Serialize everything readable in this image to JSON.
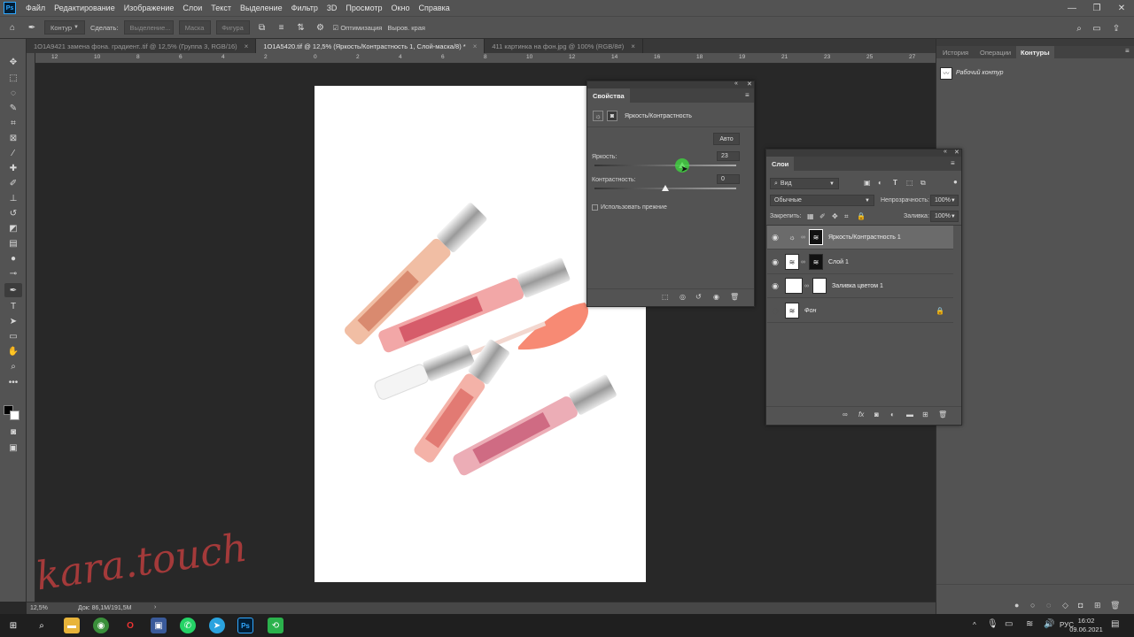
{
  "menubar": {
    "logo": "Ps",
    "items": [
      "Файл",
      "Редактирование",
      "Изображение",
      "Слои",
      "Текст",
      "Выделение",
      "Фильтр",
      "3D",
      "Просмотр",
      "Окно",
      "Справка"
    ]
  },
  "options": {
    "mode": "Контур",
    "make_label": "Сделать:",
    "selection_btn": "Выделение...",
    "mask_btn": "Маска",
    "shape_btn": "Фигура",
    "optimization_label": "Оптимизация",
    "align_edges_label": "Выров. края"
  },
  "doc_tabs": [
    {
      "label": "1O1A9421 замена фона. градиент..tif @ 12,5% (Группа 3, RGB/16)",
      "active": false
    },
    {
      "label": "1O1A5420.tif @ 12,5% (Яркость/Контрастность 1, Слой-маска/8) *",
      "active": true
    },
    {
      "label": "411 картинка на фон.jpg @ 100% (RGB/8#)",
      "active": false
    }
  ],
  "ruler_top": [
    "12",
    "10",
    "8",
    "6",
    "4",
    "2",
    "0",
    "2",
    "4",
    "6",
    "8",
    "10",
    "12",
    "14",
    "16",
    "18",
    "19",
    "21",
    "23",
    "25",
    "27"
  ],
  "status": {
    "zoom": "12,5%",
    "doc_info": "Док: 86,1M/191,5M"
  },
  "right_dock": {
    "tabs": [
      "История",
      "Операции",
      "Контуры"
    ],
    "active_tab": "Контуры",
    "path_item": "Рабочий контур"
  },
  "properties": {
    "tab": "Свойства",
    "adjustment_name": "Яркость/Контрастность",
    "auto_btn": "Авто",
    "brightness_label": "Яркость:",
    "brightness_value": "23",
    "brightness_level": 0.62,
    "contrast_label": "Контрастность:",
    "contrast_value": "0",
    "contrast_level": 0.5,
    "legacy_label": "Использовать прежние"
  },
  "layers": {
    "tab": "Слои",
    "filter": "Вид",
    "blend_mode": "Обычные",
    "opacity_label": "Непрозрачность:",
    "opacity_value": "100%",
    "lock_label": "Закрепить:",
    "fill_label": "Заливка:",
    "fill_value": "100%",
    "rows": [
      {
        "name": "Яркость/Контрастность 1",
        "selected": true
      },
      {
        "name": "Слой 1",
        "selected": false
      },
      {
        "name": "Заливка цветом 1",
        "selected": false
      },
      {
        "name": "Фон",
        "selected": false
      }
    ]
  },
  "watermark": "kara.touch",
  "taskbar": {
    "lang": "РУС",
    "time": "16:02",
    "date": "09.06.2021"
  }
}
